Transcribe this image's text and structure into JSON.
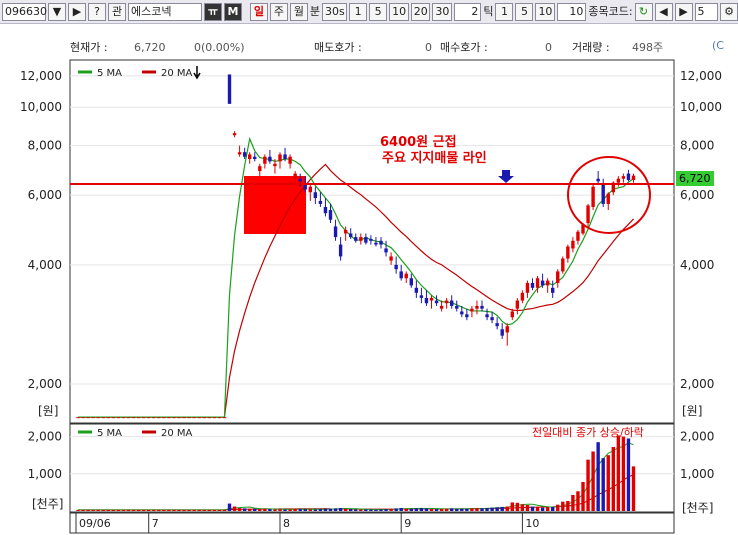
{
  "toolbar": {
    "code": "096630",
    "name": "에스코넥",
    "period_buttons": [
      "일",
      "주",
      "월"
    ],
    "minute_label": "분",
    "minute_options": [
      "30s",
      "1",
      "5",
      "10",
      "20",
      "30"
    ],
    "tick_value": "2",
    "tick_label": "틱",
    "tick_options": [
      "1",
      "5",
      "10"
    ],
    "tick_count": "10",
    "code_label": "종목코드:",
    "count_value": "5",
    "btn_question": "?",
    "btn_gwan": "관",
    "btn_m": "M",
    "btn_t": "ㅠ"
  },
  "quote": {
    "price_label": "현재가 :",
    "price": "6,720",
    "change": "0(0.00%)",
    "ask_label": "매도호가 :",
    "ask": "0",
    "bid_label": "매수호가 :",
    "bid": "0",
    "volume_label": "거래량 :",
    "volume": "498주",
    "extra": "(C"
  },
  "price_panel": {
    "legend": [
      {
        "label": "5 MA",
        "color": "#1aa01a"
      },
      {
        "label": "20 MA",
        "color": "#c00000"
      }
    ],
    "unit": "[원]",
    "left_ticks": [
      "12,000",
      "10,000",
      "8,000",
      "6,000",
      "4,000",
      "2,000"
    ],
    "right_ticks": [
      "12,000",
      "10,000",
      "8,000",
      "6,000",
      "4,000",
      "2,000"
    ],
    "current_price_tag": "6,720",
    "annotation_line1": "6400원 근접",
    "annotation_line2": "주요 지지매물 라인",
    "support_level": 6400
  },
  "volume_panel": {
    "legend": [
      {
        "label": "5 MA",
        "color": "#1aa01a"
      },
      {
        "label": "20 MA",
        "color": "#c00000"
      }
    ],
    "caption": "전일대비 종가 상승/하락",
    "unit": "[천주]",
    "left_ticks": [
      "2,000",
      "1,000"
    ],
    "right_ticks": [
      "2,000",
      "1,000"
    ]
  },
  "x_axis": {
    "labels": [
      "09/06",
      "7",
      "8",
      "9",
      "10"
    ]
  },
  "colors": {
    "up": "#e00000",
    "down": "#1a1ab0",
    "ma5": "#1aa01a",
    "ma20": "#c00000",
    "support": "#e00000",
    "tag_bg": "#33cc33"
  },
  "chart_data": {
    "type": "candlestick",
    "price_scale": "log",
    "ylim": [
      1500,
      12500
    ],
    "candles": [
      [
        1650,
        1650,
        1650,
        1650
      ],
      [
        1650,
        1650,
        1650,
        1650
      ],
      [
        1650,
        1650,
        1650,
        1650
      ],
      [
        1650,
        1650,
        1650,
        1650
      ],
      [
        1650,
        1650,
        1650,
        1650
      ],
      [
        1650,
        1650,
        1650,
        1650
      ],
      [
        1650,
        1650,
        1650,
        1650
      ],
      [
        1650,
        1650,
        1650,
        1650
      ],
      [
        1650,
        1650,
        1650,
        1650
      ],
      [
        1650,
        1650,
        1650,
        1650
      ],
      [
        1650,
        1650,
        1650,
        1650
      ],
      [
        1650,
        1650,
        1650,
        1650
      ],
      [
        1650,
        1650,
        1650,
        1650
      ],
      [
        1650,
        1650,
        1650,
        1650
      ],
      [
        1650,
        1650,
        1650,
        1650
      ],
      [
        1650,
        1650,
        1650,
        1650
      ],
      [
        1650,
        1650,
        1650,
        1650
      ],
      [
        1650,
        1650,
        1650,
        1650
      ],
      [
        1650,
        1650,
        1650,
        1650
      ],
      [
        1650,
        1650,
        1650,
        1650
      ],
      [
        1650,
        1650,
        1650,
        1650
      ],
      [
        1650,
        1650,
        1650,
        1650
      ],
      [
        1650,
        1650,
        1650,
        1650
      ],
      [
        1650,
        1650,
        1650,
        1650
      ],
      [
        1650,
        1650,
        1650,
        1650
      ],
      [
        1650,
        1650,
        1650,
        1650
      ],
      [
        1650,
        1650,
        1650,
        1650
      ],
      [
        1650,
        1650,
        1650,
        1650
      ],
      [
        1650,
        1650,
        1650,
        1650
      ],
      [
        1650,
        1650,
        1650,
        1650
      ],
      [
        12100,
        12100,
        10200,
        10200
      ],
      [
        8500,
        8700,
        8400,
        8600
      ],
      [
        7600,
        8000,
        7500,
        7700
      ],
      [
        7700,
        7900,
        7400,
        7500
      ],
      [
        7400,
        7700,
        7200,
        7600
      ],
      [
        7500,
        7700,
        7300,
        7400
      ],
      [
        6900,
        7200,
        6700,
        7100
      ],
      [
        7200,
        7600,
        7000,
        7500
      ],
      [
        7500,
        7800,
        7200,
        7300
      ],
      [
        7100,
        7400,
        6800,
        7200
      ],
      [
        7300,
        7700,
        7000,
        7600
      ],
      [
        7600,
        7900,
        7300,
        7400
      ],
      [
        7200,
        7600,
        7000,
        7500
      ],
      [
        6600,
        6900,
        6400,
        6800
      ],
      [
        6600,
        6800,
        6300,
        6500
      ],
      [
        6400,
        6700,
        6100,
        6200
      ],
      [
        6100,
        6400,
        5800,
        6300
      ],
      [
        6100,
        6300,
        5700,
        5900
      ],
      [
        5800,
        6100,
        5600,
        5700
      ],
      [
        5600,
        5900,
        5300,
        5400
      ],
      [
        5500,
        5700,
        5100,
        5200
      ],
      [
        5000,
        5200,
        4600,
        4700
      ],
      [
        4500,
        4700,
        4100,
        4200
      ],
      [
        4800,
        5000,
        4600,
        4900
      ],
      [
        4800,
        4950,
        4650,
        4700
      ],
      [
        4700,
        4800,
        4550,
        4600
      ],
      [
        4600,
        4800,
        4500,
        4700
      ],
      [
        4700,
        4800,
        4500,
        4550
      ],
      [
        4650,
        4750,
        4500,
        4600
      ],
      [
        4550,
        4700,
        4450,
        4500
      ],
      [
        4600,
        4700,
        4400,
        4500
      ],
      [
        4400,
        4600,
        4200,
        4300
      ],
      [
        4100,
        4300,
        4000,
        4200
      ],
      [
        4000,
        4200,
        3800,
        3900
      ],
      [
        3850,
        4000,
        3650,
        3700
      ],
      [
        3700,
        3850,
        3600,
        3800
      ],
      [
        3700,
        3800,
        3500,
        3550
      ],
      [
        3500,
        3650,
        3300,
        3400
      ],
      [
        3350,
        3500,
        3200,
        3300
      ],
      [
        3300,
        3450,
        3150,
        3200
      ],
      [
        3250,
        3350,
        3100,
        3300
      ],
      [
        3250,
        3350,
        3150,
        3200
      ],
      [
        3100,
        3250,
        3050,
        3150
      ],
      [
        3200,
        3300,
        3100,
        3250
      ],
      [
        3250,
        3350,
        3100,
        3150
      ],
      [
        3150,
        3250,
        3050,
        3100
      ],
      [
        3050,
        3150,
        2950,
        3000
      ],
      [
        3000,
        3100,
        2900,
        2950
      ],
      [
        3050,
        3150,
        2950,
        3100
      ],
      [
        3100,
        3250,
        3000,
        3150
      ],
      [
        3150,
        3250,
        3050,
        3100
      ],
      [
        3000,
        3100,
        2900,
        2950
      ],
      [
        2950,
        3050,
        2850,
        2900
      ],
      [
        2850,
        2950,
        2750,
        2800
      ],
      [
        2750,
        2850,
        2600,
        2650
      ],
      [
        2700,
        2850,
        2500,
        2800
      ],
      [
        2950,
        3100,
        2900,
        3050
      ],
      [
        3100,
        3300,
        3000,
        3250
      ],
      [
        3250,
        3450,
        3200,
        3400
      ],
      [
        3400,
        3650,
        3300,
        3600
      ],
      [
        3600,
        3700,
        3450,
        3500
      ],
      [
        3500,
        3750,
        3400,
        3700
      ],
      [
        3650,
        3800,
        3500,
        3550
      ],
      [
        3550,
        3700,
        3400,
        3650
      ],
      [
        3500,
        3650,
        3300,
        3400
      ],
      [
        3600,
        3900,
        3500,
        3850
      ],
      [
        3850,
        4200,
        3800,
        4150
      ],
      [
        4150,
        4500,
        4050,
        4450
      ],
      [
        4400,
        4700,
        4300,
        4600
      ],
      [
        4600,
        4900,
        4500,
        4850
      ],
      [
        4800,
        5100,
        4750,
        5050
      ],
      [
        5100,
        5700,
        5000,
        5650
      ],
      [
        5600,
        6400,
        5500,
        6300
      ],
      [
        6600,
        6900,
        6400,
        6500
      ],
      [
        6400,
        6600,
        5600,
        5700
      ],
      [
        5700,
        6100,
        5500,
        6050
      ],
      [
        6100,
        6500,
        6000,
        6450
      ],
      [
        6450,
        6700,
        6300,
        6600
      ],
      [
        6600,
        6800,
        6450,
        6700
      ],
      [
        6800,
        6950,
        6500,
        6550
      ],
      [
        6550,
        6800,
        6450,
        6720
      ]
    ],
    "volumes": [
      30,
      30,
      30,
      30,
      30,
      30,
      30,
      30,
      30,
      30,
      30,
      30,
      30,
      30,
      30,
      30,
      30,
      30,
      30,
      30,
      30,
      30,
      30,
      30,
      30,
      30,
      30,
      30,
      30,
      30,
      200,
      120,
      80,
      70,
      60,
      60,
      50,
      60,
      50,
      40,
      50,
      40,
      40,
      60,
      50,
      50,
      40,
      40,
      50,
      60,
      60,
      70,
      80,
      60,
      50,
      40,
      40,
      40,
      40,
      30,
      40,
      50,
      60,
      70,
      80,
      60,
      60,
      70,
      80,
      70,
      50,
      50,
      50,
      60,
      70,
      60,
      60,
      60,
      70,
      80,
      70,
      80,
      90,
      100,
      110,
      120,
      230,
      220,
      180,
      160,
      120,
      100,
      90,
      100,
      110,
      170,
      250,
      270,
      430,
      530,
      780,
      1380,
      1600,
      1850,
      1420,
      1500,
      1720,
      2030,
      2000,
      1950,
      1200
    ]
  }
}
